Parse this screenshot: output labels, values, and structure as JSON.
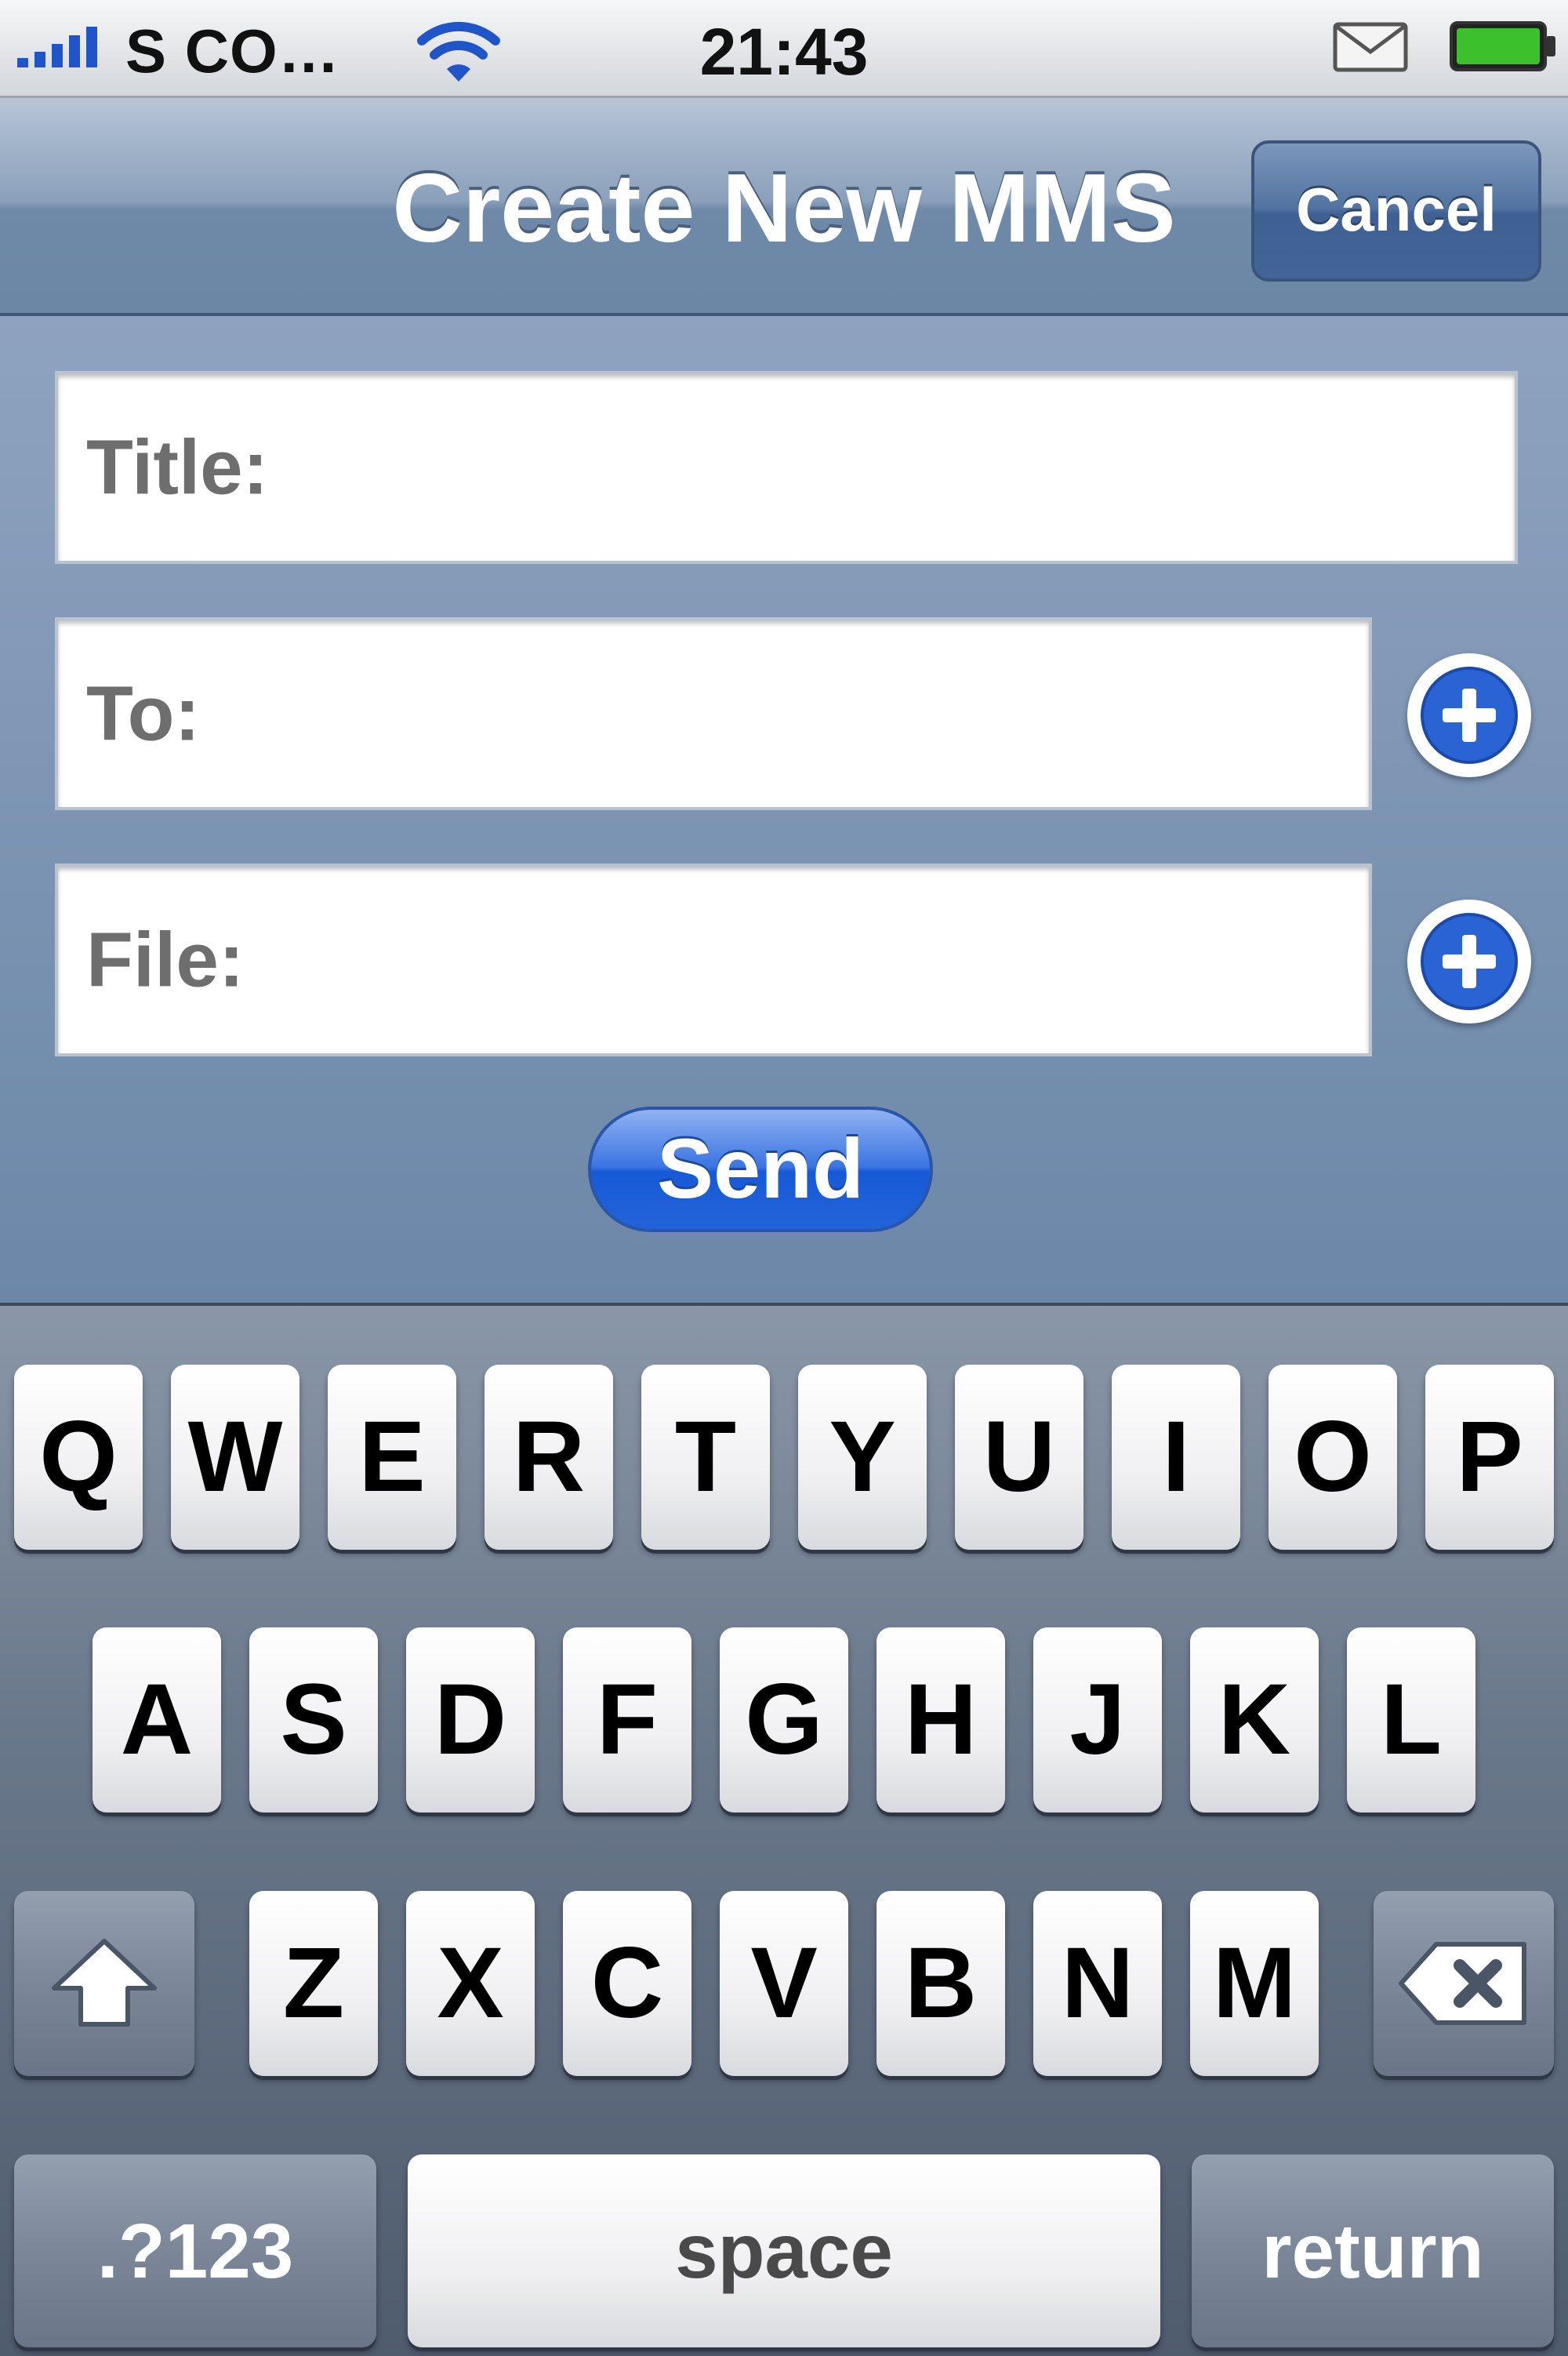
{
  "status_bar": {
    "carrier": "S CO…",
    "time": "21:43",
    "icons": [
      "signal-bars-icon",
      "wifi-icon",
      "mail-icon",
      "battery-icon"
    ]
  },
  "nav": {
    "title": "Create New MMS",
    "cancel_label": "Cancel"
  },
  "form": {
    "title_label": "Title:",
    "to_label": "To:",
    "file_label": "File:",
    "send_label": "Send"
  },
  "keyboard": {
    "row1": [
      "Q",
      "W",
      "E",
      "R",
      "T",
      "Y",
      "U",
      "I",
      "O",
      "P"
    ],
    "row2": [
      "A",
      "S",
      "D",
      "F",
      "G",
      "H",
      "J",
      "K",
      "L"
    ],
    "row3": [
      "Z",
      "X",
      "C",
      "V",
      "B",
      "N",
      "M"
    ],
    "numbers_label": ".?123",
    "space_label": "space",
    "return_label": "return"
  },
  "colors": {
    "nav_bar": "#6c86a5",
    "send_button": "#2363d9",
    "add_icon": "#2a64d4"
  }
}
